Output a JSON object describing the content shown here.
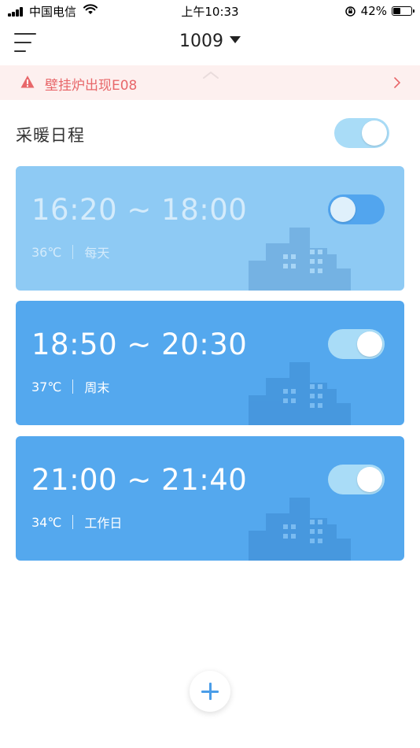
{
  "status_bar": {
    "carrier": "中国电信",
    "time": "上午10:33",
    "battery": "42%",
    "battery_level": 0.42,
    "icons": [
      "signal-icon",
      "wifi-icon",
      "orientation-lock-icon",
      "battery-icon"
    ]
  },
  "header": {
    "menu_icon": "menu-icon",
    "device": "1009",
    "dropdown_icon": "caret-down-icon"
  },
  "alert": {
    "icon": "warning-icon",
    "message": "壁挂炉出现E08",
    "arrow_icon": "chevron-right-icon",
    "colors": {
      "background": "#fdf0ef",
      "text": "#e8676a"
    }
  },
  "schedule": {
    "title": "采暖日程",
    "master_enabled": true,
    "items": [
      {
        "time": "16:20 ~ 18:00",
        "temperature": "36℃",
        "repeat": "每天",
        "enabled": false
      },
      {
        "time": "18:50 ~ 20:30",
        "temperature": "37℃",
        "repeat": "周末",
        "enabled": true
      },
      {
        "time": "21:00 ~ 21:40",
        "temperature": "34℃",
        "repeat": "工作日",
        "enabled": true
      }
    ]
  },
  "colors": {
    "card_enabled": "#54a8ee",
    "card_disabled": "#8ecaf4",
    "switch_on": "#a9dcf7",
    "accent": "#4a9de8"
  },
  "add_button": {
    "icon": "plus-icon"
  }
}
